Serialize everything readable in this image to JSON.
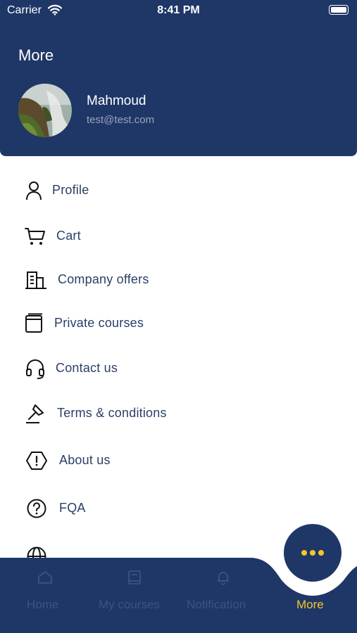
{
  "status_bar": {
    "carrier": "Carrier",
    "time": "8:41 PM"
  },
  "header": {
    "title": "More",
    "user_name": "Mahmoud",
    "user_email": "test@test.com"
  },
  "menu": {
    "items": [
      {
        "label": "Profile",
        "icon": "person-icon"
      },
      {
        "label": "Cart",
        "icon": "cart-icon"
      },
      {
        "label": "Company offers",
        "icon": "building-icon"
      },
      {
        "label": "Private courses",
        "icon": "book-icon"
      },
      {
        "label": "Contact us",
        "icon": "headset-icon"
      },
      {
        "label": "Terms & conditions",
        "icon": "gavel-icon"
      },
      {
        "label": "About us",
        "icon": "alert-hexagon-icon"
      },
      {
        "label": "FQA",
        "icon": "question-circle-icon"
      },
      {
        "label": "",
        "icon": "globe-icon"
      }
    ]
  },
  "tabbar": {
    "active": "More",
    "colors": {
      "bar": "#1f3767",
      "inactive": "#3a5481",
      "active": "#f3c52e"
    },
    "tabs": [
      {
        "label": "Home",
        "icon": "home-icon"
      },
      {
        "label": "My courses",
        "icon": "book-icon"
      },
      {
        "label": "Notification",
        "icon": "bell-icon"
      },
      {
        "label": "More",
        "icon": "more-dots-icon"
      }
    ]
  }
}
